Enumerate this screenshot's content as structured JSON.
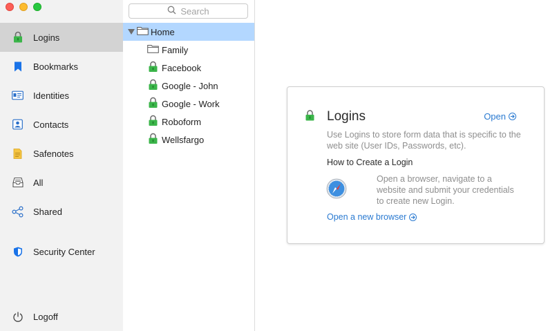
{
  "sidebar": {
    "items": [
      {
        "label": "Logins",
        "icon": "lock-icon"
      },
      {
        "label": "Bookmarks",
        "icon": "bookmark-icon"
      },
      {
        "label": "Identities",
        "icon": "identity-card-icon"
      },
      {
        "label": "Contacts",
        "icon": "contact-icon"
      },
      {
        "label": "Safenotes",
        "icon": "note-icon"
      },
      {
        "label": "All",
        "icon": "inbox-icon"
      },
      {
        "label": "Shared",
        "icon": "share-icon"
      },
      {
        "label": "Security Center",
        "icon": "shield-icon"
      },
      {
        "label": "Logoff",
        "icon": "power-icon"
      }
    ],
    "active": "Logins"
  },
  "search": {
    "placeholder": "Search"
  },
  "tree": {
    "root": "Home",
    "items": [
      "Family",
      "Facebook",
      "Google - John",
      "Google - Work",
      "Roboform",
      "Wellsfargo"
    ]
  },
  "card": {
    "title": "Logins",
    "open_label": "Open",
    "description": "Use Logins to store form data that is specific to the web site (User IDs, Passwords, etc).",
    "howto_title": "How to Create a Login",
    "steps": "Open a browser, navigate to a website and submit your credentials to create new Login.",
    "browser_link": "Open a new browser"
  },
  "colors": {
    "accent": "#2a7ad1",
    "lock_green": "#3bb54a",
    "selected_row": "#b3d7ff",
    "sidebar_active": "#d3d3d3"
  }
}
